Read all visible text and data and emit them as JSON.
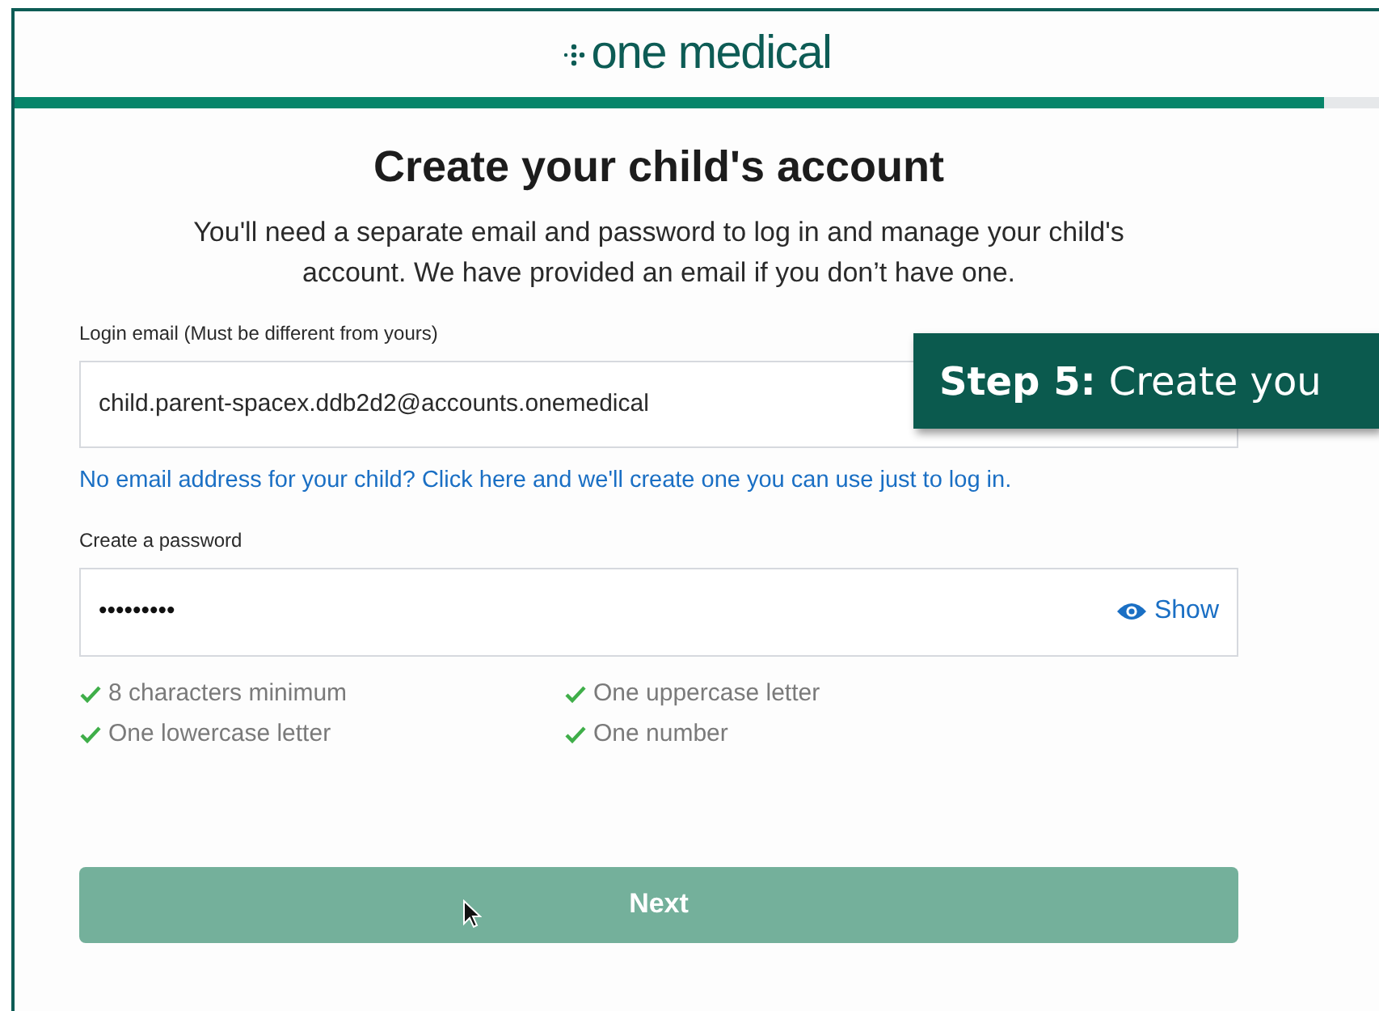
{
  "logo": {
    "text": "one medical"
  },
  "progress": {
    "level": 0.96
  },
  "heading": "Create your child's account",
  "intro": "You'll need a separate email and password to log in and manage your child's account. We have provided an email if you don’t have one.",
  "email_field": {
    "label": "Login email (Must be different from yours)",
    "value": "child.parent-spacex.ddb2d2@accounts.onemedical"
  },
  "email_link": "No email address for your child? Click here and we'll create one you can use just to log in.",
  "password_field": {
    "label": "Create a password",
    "value": "•••••••••",
    "toggle": "Show"
  },
  "requirements": [
    {
      "text": "8 characters minimum",
      "met": true
    },
    {
      "text": "One uppercase letter",
      "met": true
    },
    {
      "text": "One lowercase letter",
      "met": true
    },
    {
      "text": "One number",
      "met": true
    }
  ],
  "next_button": {
    "label": "Next",
    "disabled": true
  },
  "callout": {
    "bold": "Step 5:",
    "text": "Create you"
  }
}
